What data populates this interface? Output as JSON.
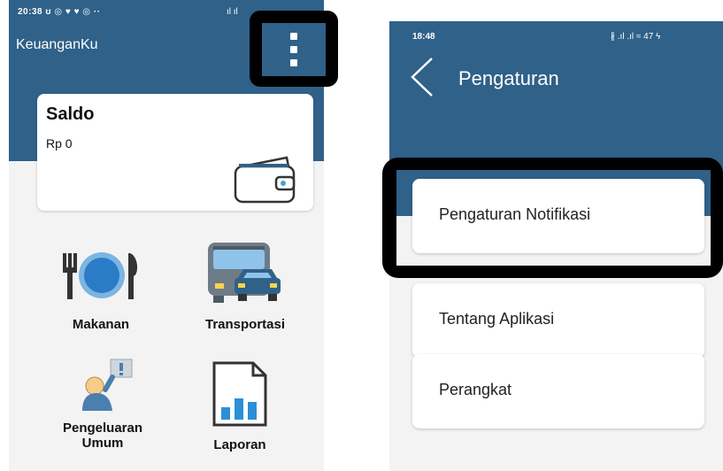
{
  "left_screen": {
    "status_time": "20:38",
    "status_icons": "ʊ ◎ ♥ ♥ ◎ ··",
    "status_signal": "ıl ıl",
    "app_title": "KeuanganKu",
    "saldo": {
      "title": "Saldo",
      "value": "Rp 0"
    },
    "menu": [
      {
        "label": "Makanan",
        "icon": "plate-cutlery-icon"
      },
      {
        "label": "Transportasi",
        "icon": "bus-car-icon"
      },
      {
        "label": "Pengeluaran\nUmum",
        "icon": "person-sign-icon"
      },
      {
        "label": "Laporan",
        "icon": "report-chart-icon"
      }
    ]
  },
  "right_screen": {
    "status_time": "18:48",
    "status_right": "∦ .ıl .ıl ≈ 47 ϟ",
    "title": "Pengaturan",
    "items": [
      {
        "label": "Pengaturan Notifikasi"
      },
      {
        "label": "Tentang Aplikasi"
      },
      {
        "label": "Perangkat"
      }
    ]
  },
  "colors": {
    "header": "#2f6189",
    "highlight": "#000000",
    "card": "#ffffff",
    "background": "#f3f3f3"
  }
}
